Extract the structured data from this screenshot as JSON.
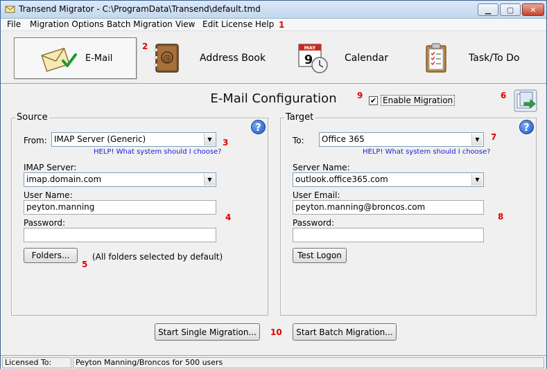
{
  "window": {
    "title": "Transend Migrator - C:\\ProgramData\\Transend\\default.tmd"
  },
  "menu": [
    "File",
    "Migration Options",
    "Batch Migration",
    "View",
    "Edit License",
    "Help"
  ],
  "annotations": {
    "a1": "1",
    "a2": "2",
    "a3": "3",
    "a4": "4",
    "a5": "5",
    "a6": "6",
    "a7": "7",
    "a8": "8",
    "a9": "9",
    "a10": "10"
  },
  "toolbar": {
    "email": "E-Mail",
    "address_book": "Address Book",
    "calendar": "Calendar",
    "calendar_month": "MAY",
    "calendar_day": "9",
    "tasks": "Task/To Do"
  },
  "config": {
    "title": "E-Mail Configuration",
    "enable_label": "Enable Migration",
    "enable_checked": true
  },
  "source": {
    "legend": "Source",
    "from_label": "From:",
    "from_value": "IMAP Server (Generic)",
    "help_link": "HELP! What system should I choose?",
    "server_label": "IMAP Server:",
    "server_value": "imap.domain.com",
    "user_label": "User Name:",
    "user_value": "peyton.manning",
    "password_label": "Password:",
    "password_value": "",
    "folders_button": "Folders...",
    "folders_note": "(All folders selected by default)"
  },
  "target": {
    "legend": "Target",
    "to_label": "To:",
    "to_value": "Office 365",
    "help_link": "HELP! What system should I choose?",
    "server_label": "Server Name:",
    "server_value": "outlook.office365.com",
    "email_label": "User Email:",
    "email_value": "peyton.manning@broncos.com",
    "password_label": "Password:",
    "password_value": "",
    "test_button": "Test Logon"
  },
  "actions": {
    "single": "Start Single Migration...",
    "batch": "Start Batch Migration..."
  },
  "status": {
    "licensed_label": "Licensed To:",
    "licensed_value": "Peyton Manning/Broncos for 500 users"
  },
  "colors": {
    "annotation": "#e00000",
    "help_link": "#1a1ad6",
    "titlebar": "#c3d7ee"
  }
}
